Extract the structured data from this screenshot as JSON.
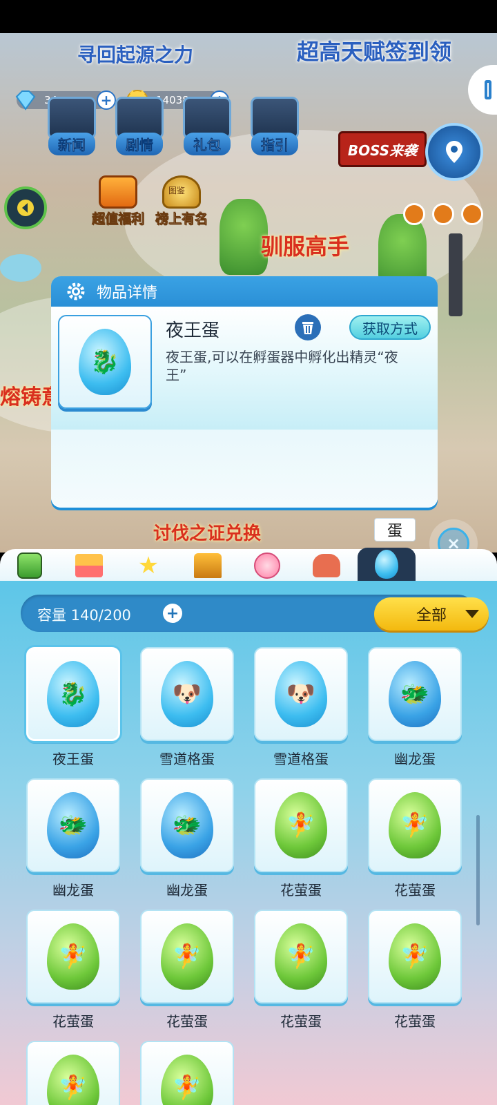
{
  "scene": {
    "banner_top": "寻回起源之力",
    "banner_sign": "超高天赋签到领",
    "banner_boss": "BOSS来袭",
    "banner_tame": "驯服高手",
    "banner_cast": "熔铸意",
    "banner_bottom": "讨伐之证兑换"
  },
  "currency": {
    "gems": "34",
    "coins": "14038"
  },
  "menu": {
    "news": "新闻",
    "story": "剧情",
    "gift": "礼包",
    "guide": "指引",
    "welfare": "超值福利",
    "ranking": "榜上有名",
    "ranking_badge": "图鉴"
  },
  "popup": {
    "title": "物品详情",
    "item_name": "夜王蛋",
    "obtain_label": "获取方式",
    "description": "夜王蛋,可以在孵蛋器中孵化出精灵“夜王”"
  },
  "tabs": {
    "active_tip": "蛋",
    "close_label": "×"
  },
  "inventory": {
    "capacity_label": "容量 140/200",
    "filter_label": "全部",
    "items": [
      {
        "name": "夜王蛋",
        "egg": "blue",
        "face": "🐉",
        "selected": true
      },
      {
        "name": "雪道格蛋",
        "egg": "blue",
        "face": "🐶",
        "selected": false
      },
      {
        "name": "雪道格蛋",
        "egg": "blue",
        "face": "🐶",
        "selected": false
      },
      {
        "name": "幽龙蛋",
        "egg": "darkblue",
        "face": "🐲",
        "selected": false
      },
      {
        "name": "幽龙蛋",
        "egg": "darkblue",
        "face": "🐲",
        "selected": false
      },
      {
        "name": "幽龙蛋",
        "egg": "darkblue",
        "face": "🐲",
        "selected": false
      },
      {
        "name": "花萤蛋",
        "egg": "green",
        "face": "🧚",
        "selected": false
      },
      {
        "name": "花萤蛋",
        "egg": "green",
        "face": "🧚",
        "selected": false
      },
      {
        "name": "花萤蛋",
        "egg": "green",
        "face": "🧚",
        "selected": false
      },
      {
        "name": "花萤蛋",
        "egg": "green",
        "face": "🧚",
        "selected": false
      },
      {
        "name": "花萤蛋",
        "egg": "green",
        "face": "🧚",
        "selected": false
      },
      {
        "name": "花萤蛋",
        "egg": "green",
        "face": "🧚",
        "selected": false
      },
      {
        "name": "",
        "egg": "green",
        "face": "🧚",
        "selected": false
      },
      {
        "name": "",
        "egg": "green",
        "face": "🧚",
        "selected": false
      }
    ]
  },
  "colors": {
    "accent": "#2a8fd6",
    "filter": "#f3b90f",
    "tab_active": "#233852"
  }
}
